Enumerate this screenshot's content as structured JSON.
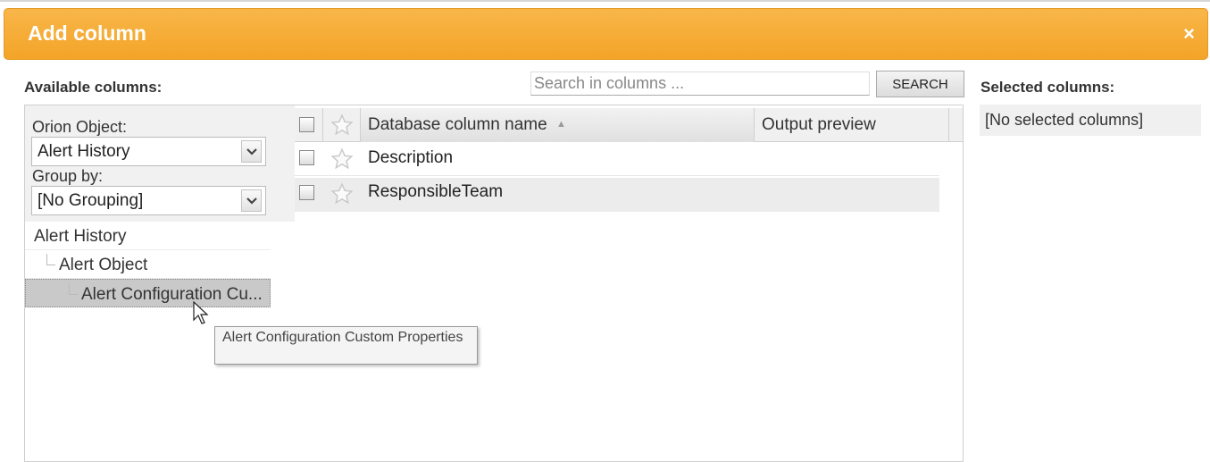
{
  "dialog": {
    "title": "Add column",
    "close_glyph": "×"
  },
  "available": {
    "label": "Available columns:",
    "orion_object_label": "Orion Object:",
    "orion_object_value": "Alert History",
    "group_by_label": "Group by:",
    "group_by_value": "[No Grouping]",
    "tree": [
      {
        "label": "Alert History",
        "level": 0
      },
      {
        "label": "Alert Object",
        "level": 1
      },
      {
        "label": "Alert Configuration Cu...",
        "level": 2,
        "selected": true
      }
    ]
  },
  "search": {
    "placeholder": "Search in columns ...",
    "button_label": "SEARCH"
  },
  "grid": {
    "columns": [
      "Database column name",
      "Output preview"
    ],
    "sort_indicator": "▲",
    "rows": [
      "Description",
      "ResponsibleTeam"
    ]
  },
  "selected": {
    "label": "Selected columns:",
    "empty_text": "[No selected columns]"
  },
  "tooltip": {
    "text": "Alert Configuration Custom Properties"
  },
  "icons": {
    "close": "close-icon",
    "dropdown": "chevron-down-icon",
    "star": "star-icon",
    "cursor": "mouse-pointer-icon"
  },
  "colors": {
    "titlebar": "#f4a428",
    "selected_row": "#c9c9c9"
  }
}
